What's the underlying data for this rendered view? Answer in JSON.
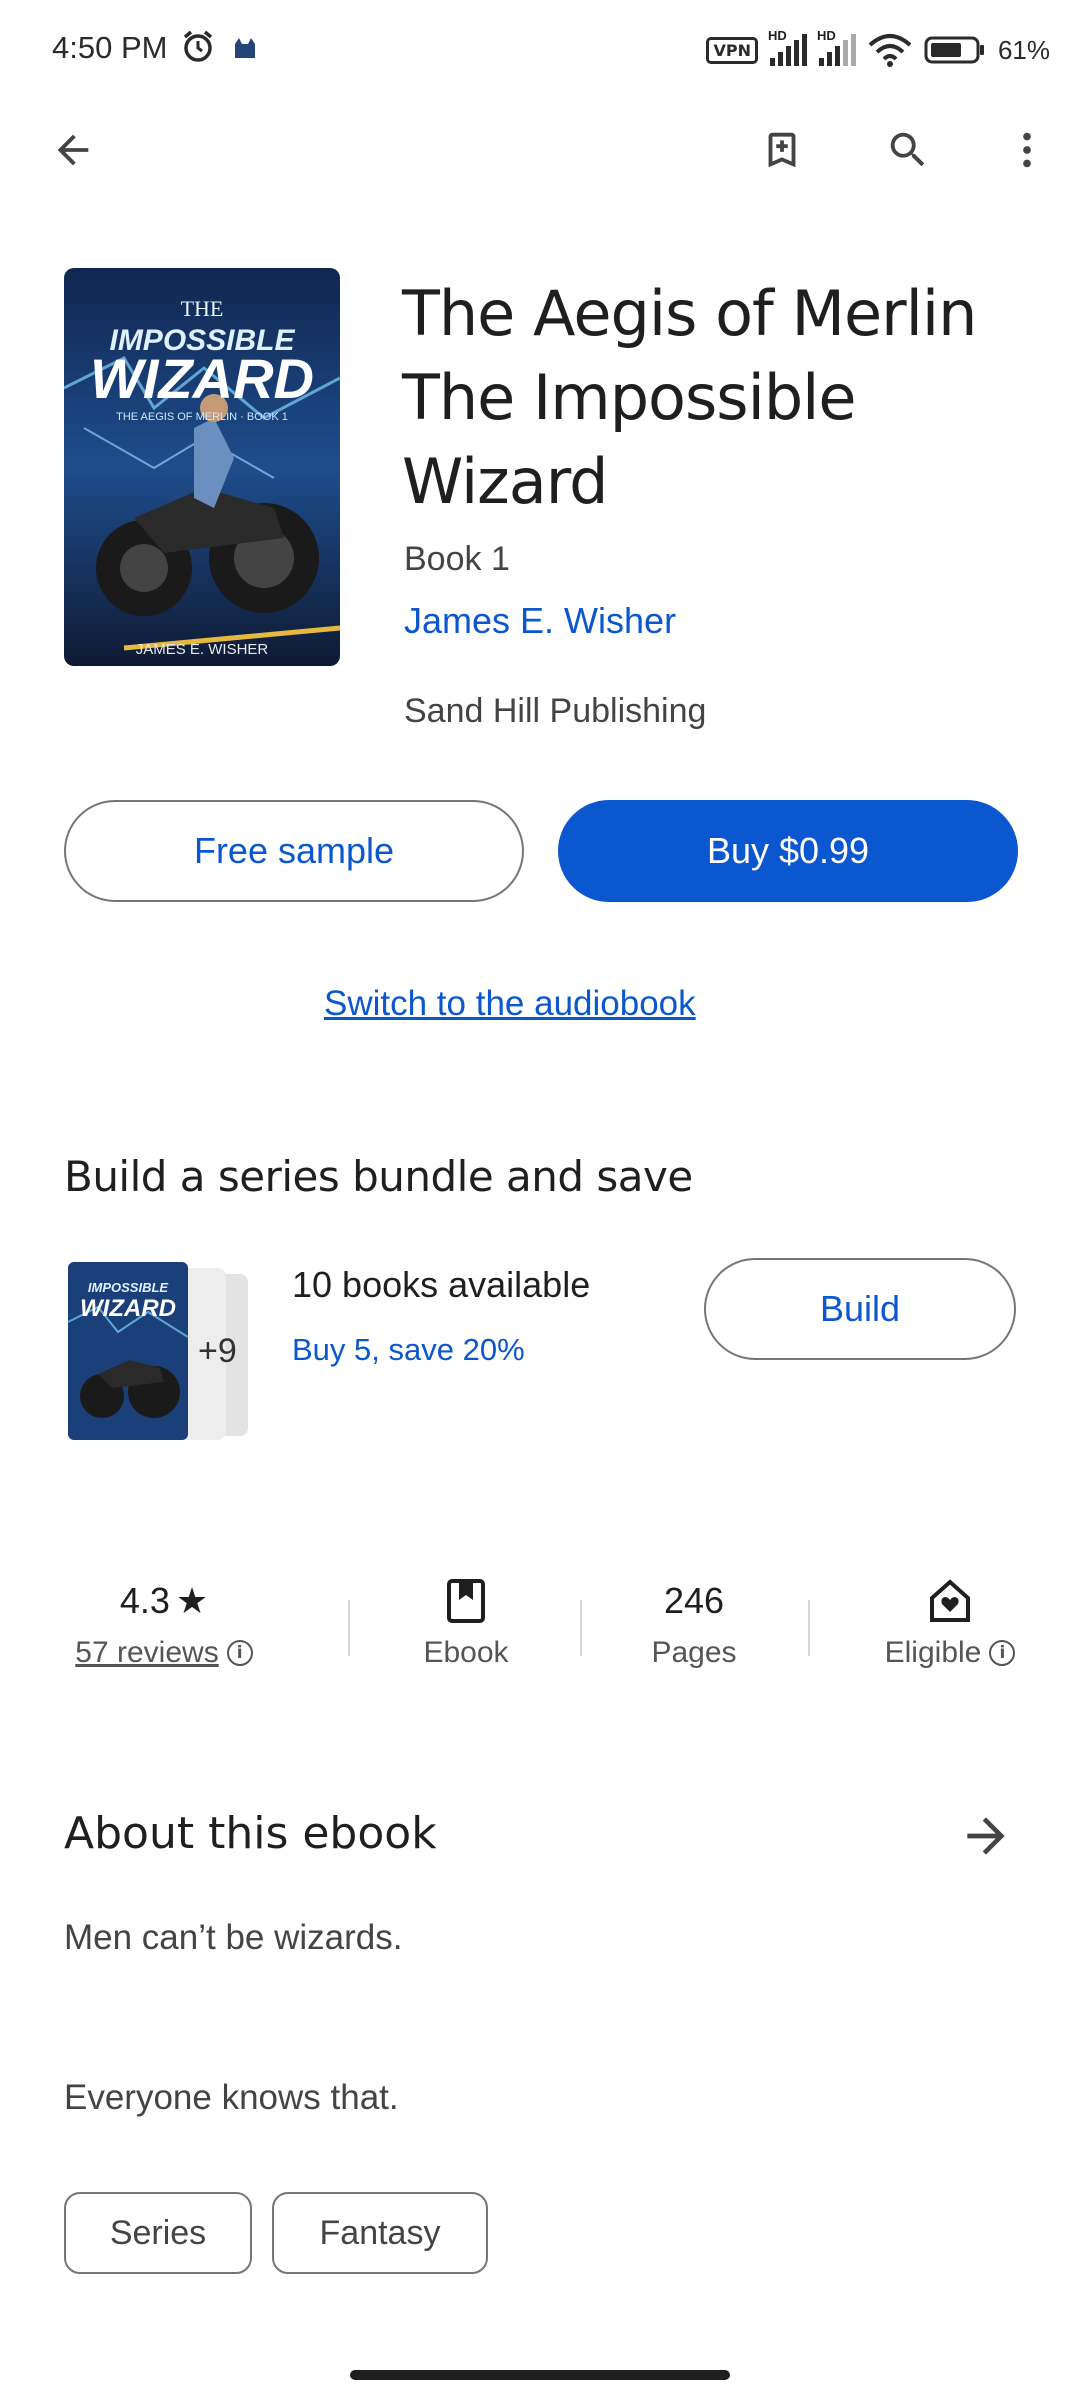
{
  "status_bar": {
    "time": "4:50 PM",
    "vpn": "VPN",
    "hd1": "HD",
    "hd2": "HD",
    "battery": "61%"
  },
  "book": {
    "title": "The Aegis of Merlin The Impossible Wizard",
    "series": "Book 1",
    "author": "James E. Wisher",
    "publisher": "Sand Hill Publishing",
    "cover_title_small": "THE",
    "cover_title_big1": "IMPOSSIBLE",
    "cover_title_big2": "WIZARD",
    "cover_subtitle": "THE AEGIS OF MERLIN · BOOK 1",
    "cover_author": "JAMES E. WISHER"
  },
  "actions": {
    "free_sample": "Free sample",
    "buy": "Buy $0.99",
    "audiobook": "Switch to the audiobook"
  },
  "bundle": {
    "heading": "Build a series bundle and save",
    "more_count": "+9",
    "count_text": "10 books available",
    "save_text": "Buy 5, save 20%",
    "build": "Build"
  },
  "stats": {
    "rating": "4.3",
    "reviews": "57 reviews",
    "format": "Ebook",
    "pages_value": "246",
    "pages_label": "Pages",
    "eligible": "Eligible"
  },
  "about": {
    "title": "About this ebook",
    "line1": "Men can’t be wizards.",
    "line2": "Everyone knows that.",
    "chips": [
      "Series",
      "Fantasy"
    ]
  },
  "colors": {
    "accent": "#0b57d0",
    "text": "#1f1f1f",
    "muted": "#444444"
  }
}
